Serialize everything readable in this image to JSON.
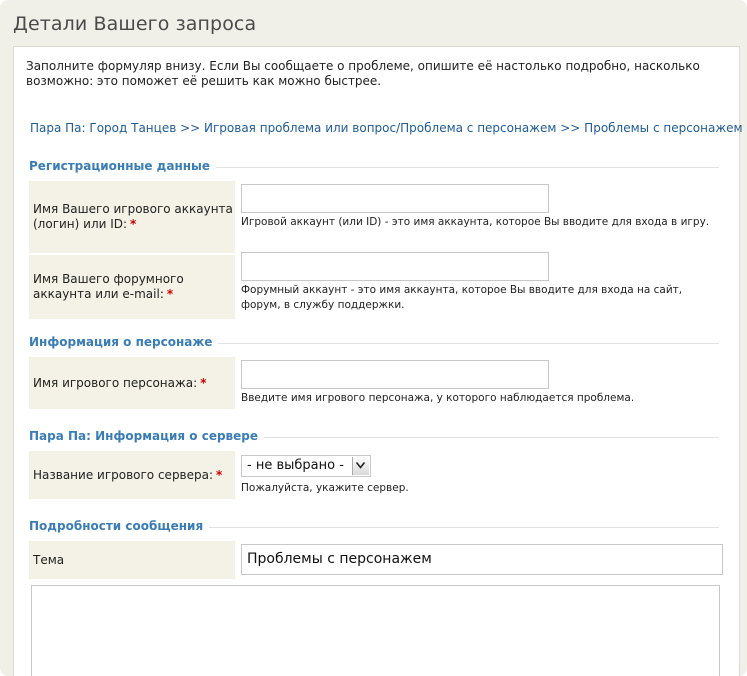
{
  "title": "Детали Вашего запроса",
  "intro": "Заполните формуляр внизу. Если Вы сообщаете о проблеме, опишите её настолько подробно, насколько возможно: это поможет её решить как можно быстрее.",
  "breadcrumb": "Пара Па: Город Танцев >> Игровая проблема или вопрос/Проблема с персонажем >> Проблемы с персонажем",
  "required_mark": "*",
  "sections": {
    "registration": "Регистрационные данные",
    "character": "Информация о персонаже",
    "server": "Пара Па: Информация о сервере",
    "details": "Подробности сообщения"
  },
  "fields": {
    "game_account": {
      "label": "Имя Вашего игрового аккаунта (логин) или ID:",
      "value": "",
      "help": "Игровой аккаунт (или ID) - это имя аккаунта, которое Вы вводите для входа в игру."
    },
    "forum_account": {
      "label": "Имя Вашего форумного аккаунта или e-mail:",
      "value": "",
      "help": "Форумный аккаунт - это имя аккаунта, которое Вы вводите для входа на сайт, форум, в службу поддержки."
    },
    "character_name": {
      "label": "Имя игрового персонажа:",
      "value": "",
      "help": "Введите имя игрового персонажа, у которого наблюдается проблема."
    },
    "server_name": {
      "label": "Название игрового сервера:",
      "selected": "- не выбрано -",
      "help": "Пожалуйста, укажите сервер."
    },
    "topic": {
      "label": "Тема",
      "value": "Проблемы с персонажем"
    },
    "message": {
      "value": ""
    }
  }
}
